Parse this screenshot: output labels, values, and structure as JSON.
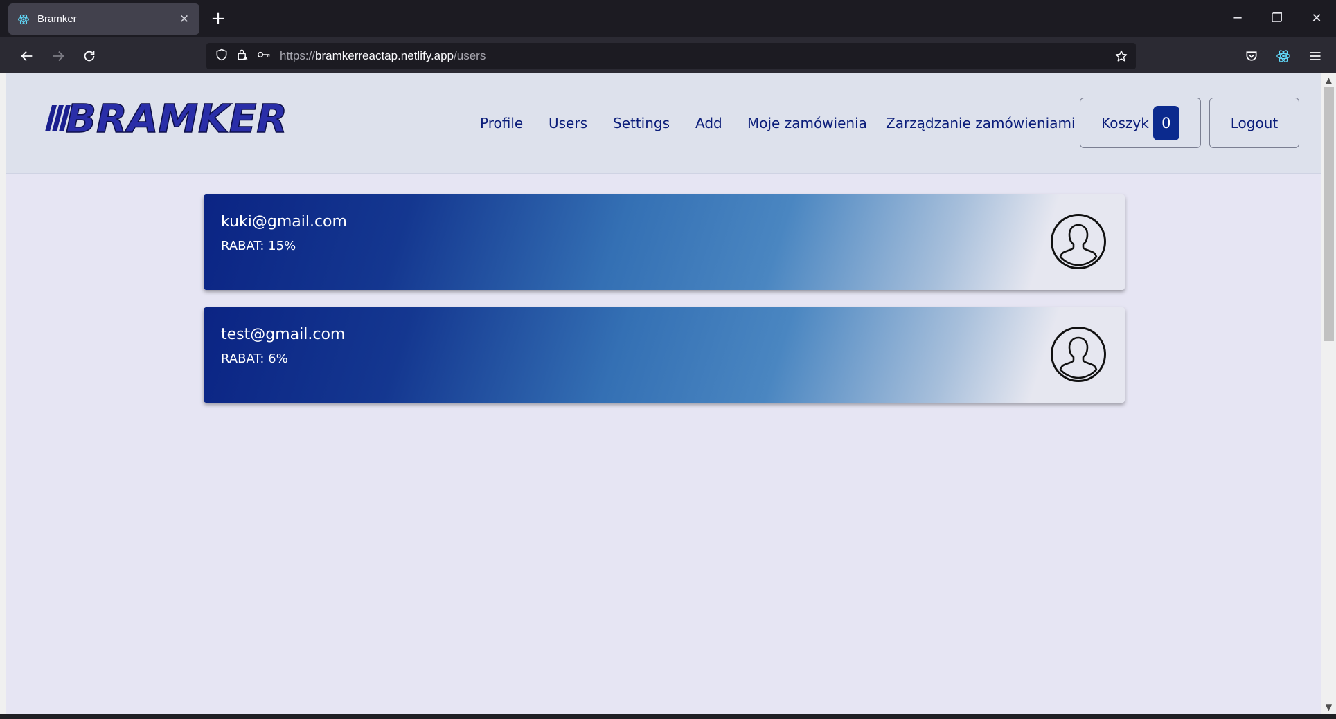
{
  "browser": {
    "tab_title": "Bramker",
    "new_tab_symbol": "+",
    "tab_close_symbol": "✕",
    "url_scheme": "https://",
    "url_host": "bramkerreactap.netlify.app",
    "url_path": "/users",
    "window": {
      "minimize": "─",
      "restore": "❐",
      "close": "✕"
    }
  },
  "site": {
    "logo_text": "BRAMKER",
    "nav": [
      "Profile",
      "Users",
      "Settings",
      "Add",
      "Moje zamówienia",
      "Zarządzanie zamówieniami"
    ],
    "cart": {
      "label": "Koszyk",
      "count": "0"
    },
    "logout_label": "Logout"
  },
  "users": [
    {
      "email": "kuki@gmail.com",
      "rabat": "RABAT: 15%"
    },
    {
      "email": "test@gmail.com",
      "rabat": "RABAT: 6%"
    }
  ],
  "colors": {
    "nav_text": "#0b1d7a",
    "header_bg": "#dde1ec",
    "page_bg": "#e6e5f3",
    "card_gradient_start": "#0b2484",
    "badge_bg": "#0b2a8e"
  },
  "icons": [
    "react-favicon-icon",
    "back-arrow-icon",
    "forward-arrow-icon",
    "reload-icon",
    "shield-icon",
    "lock-icon",
    "key-icon",
    "star-icon",
    "pocket-icon",
    "react-devtools-icon",
    "menu-icon",
    "user-avatar-icon"
  ]
}
